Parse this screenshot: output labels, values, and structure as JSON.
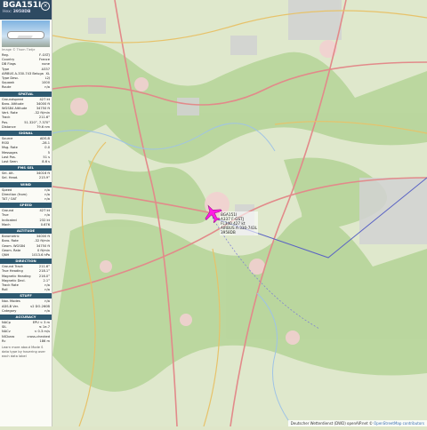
{
  "header": {
    "callsign": "BGA151I",
    "hex_label": "Hex:",
    "hex": "3958DB",
    "close_icon": "close-icon"
  },
  "photo_credit": "Image © Thom Tietje",
  "info_rows": [
    {
      "k": "Reg.",
      "v": "F-GSTJ"
    },
    {
      "k": "Country",
      "v": "France"
    },
    {
      "k": "DB Flags",
      "v": "none"
    },
    {
      "k": "Type",
      "v": "A337"
    },
    {
      "k": "AIRBUS A-330-743 Beluga",
      "v": "XL"
    },
    {
      "k": "Type Desc.",
      "v": "L2J"
    },
    {
      "k": "Squawk",
      "v": "1000"
    },
    {
      "k": "Route",
      "v": "n/a"
    }
  ],
  "sections": [
    {
      "title": "SPATIAL",
      "rows": [
        {
          "k": "Groundspeed",
          "v": "427 kt"
        },
        {
          "k": "Baro. Altitude",
          "v": "34000 ft"
        },
        {
          "k": "WGS84 Altitude",
          "v": "34750 ft"
        },
        {
          "k": "Vert. Rate",
          "v": "-32 ft/min"
        },
        {
          "k": "Track",
          "v": "211.6°"
        },
        {
          "k": "Pos.",
          "v": "51.320°, 7.370°"
        },
        {
          "k": "Distance",
          "v": "79.6 nm"
        }
      ]
    },
    {
      "title": "SIGNAL",
      "rows": [
        {
          "k": "Source",
          "v": "ADS-B"
        },
        {
          "k": "RSSI",
          "v": "-28.1"
        },
        {
          "k": "Msg. Rate",
          "v": "0.0"
        },
        {
          "k": "Messages",
          "v": "5"
        },
        {
          "k": "Last Pos.",
          "v": "51 s"
        },
        {
          "k": "Last Seen",
          "v": "8.6 s"
        }
      ]
    },
    {
      "title": "FMS SEL",
      "rows": [
        {
          "k": "Sel. Alt.",
          "v": "34016 ft"
        },
        {
          "k": "Sel. Head.",
          "v": "215.9°"
        }
      ]
    },
    {
      "title": "WIND",
      "rows": [
        {
          "k": "Speed",
          "v": "n/a"
        },
        {
          "k": "Direction (from)",
          "v": "n/a"
        },
        {
          "k": "TAT / OAT",
          "v": "n/a"
        }
      ]
    },
    {
      "title": "SPEED",
      "rows": [
        {
          "k": "Ground",
          "v": "427 kt"
        },
        {
          "k": "True",
          "v": "n/a"
        },
        {
          "k": "Indicated",
          "v": "232 kt"
        },
        {
          "k": "Mach",
          "v": "0.676"
        }
      ]
    },
    {
      "title": "ALTITUDE",
      "rows": [
        {
          "k": "Barometric",
          "v": "34000 ft"
        },
        {
          "k": "Baro. Rate",
          "v": "-32 ft/min"
        },
        {
          "k": "Geom. WGS84",
          "v": "34750 ft"
        },
        {
          "k": "Geom. Rate",
          "v": "0 ft/min"
        },
        {
          "k": "QNH",
          "v": "1013.6 hPa"
        }
      ]
    },
    {
      "title": "DIRECTION",
      "rows": [
        {
          "k": "Ground Track",
          "v": "211.6°"
        },
        {
          "k": "True Heading",
          "v": "218.1°"
        },
        {
          "k": "Magnetic Heading",
          "v": "216.0°"
        },
        {
          "k": "Magnetic Decl.",
          "v": "2.1°"
        },
        {
          "k": "Track Rate",
          "v": "n/a"
        },
        {
          "k": "Roll",
          "v": "n/a"
        }
      ]
    },
    {
      "title": "STUFF",
      "rows": [
        {
          "k": "Nav. Modes",
          "v": "n/a"
        },
        {
          "k": "ADS-B Ver.",
          "v": "v2 DO-260B"
        },
        {
          "k": "Category",
          "v": "n/a"
        }
      ]
    },
    {
      "title": "ACCURACY",
      "rows": [
        {
          "k": "NACp",
          "v": "EPU < 3 m"
        },
        {
          "k": "SIL",
          "v": "≤ 1e-7"
        },
        {
          "k": "NACv",
          "v": "< 0.3 m/s"
        },
        {
          "k": "NICbaro",
          "v": "cross-checked"
        },
        {
          "k": "Rc",
          "v": "186 m"
        }
      ]
    }
  ],
  "footer_text": "Learn more about Mode S data type by hovering over each data label",
  "map": {
    "aircraft_label": [
      "BGA151I",
      "A337 F-GSTJ",
      "FL340 427 kt",
      "AIRBUS A-330-743L",
      "3958DB"
    ],
    "attribution": "Deutscher Wetterdienst (DWD) openAIP.net © ",
    "attribution_link": "OpenStreetMap contributors",
    "aircraft_color": "#ff1de3"
  }
}
